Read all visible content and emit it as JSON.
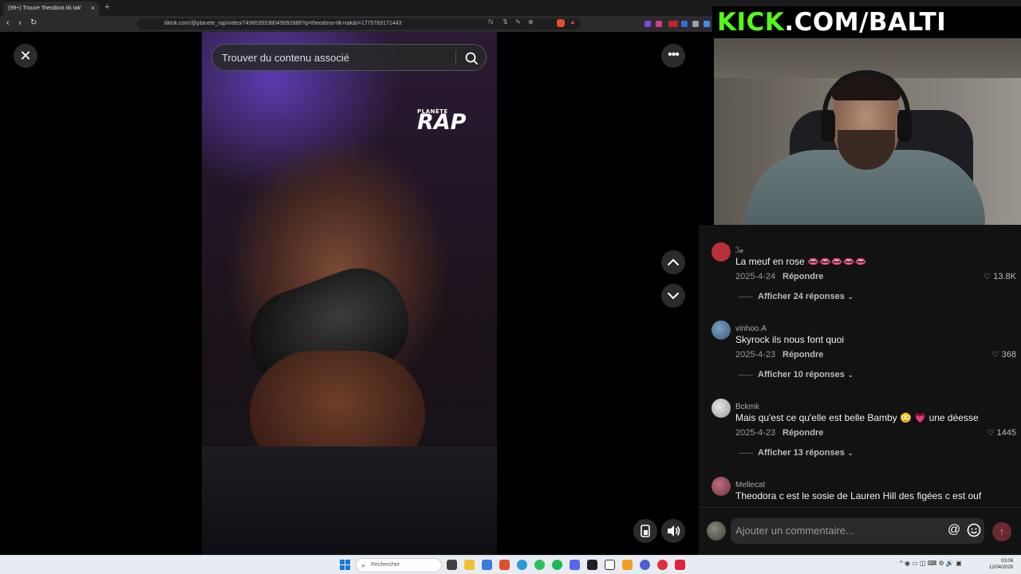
{
  "browser": {
    "tab_title": "(99+) Trouve 'theodora tik tak'",
    "tab_close": "×",
    "new_tab": "+",
    "url": "tiktok.com/@planete_rap/video/7496535538049092886?q=theodora+tik+tak&t=1775783171443"
  },
  "player": {
    "close_label": "✕",
    "search_placeholder": "Trouver du contenu associé",
    "more_label": "•••",
    "logo_small": "PLANÈTE",
    "logo_big": "RAP"
  },
  "overlay": {
    "kick_prefix": "KICK",
    "kick_suffix": ".COM/BALTI"
  },
  "comments": [
    {
      "user": "ℐ𝒶",
      "text": "La meuf en rose 👄👄👄👄👄",
      "date": "2025-4-24",
      "reply": "Répondre",
      "likes": "13.8K",
      "show_replies": "Afficher 24 réponses",
      "avatar_color": "#b8303a"
    },
    {
      "user": "vinhoo.A",
      "text": "Skyrock ils nous font quoi",
      "date": "2025-4-23",
      "reply": "Répondre",
      "likes": "368",
      "show_replies": "Afficher 10 réponses",
      "avatar_color": "#3d5a7a"
    },
    {
      "user": "Bckmk",
      "text": "Mais qu'est ce qu'elle est belle Bamby 😳 💗 une déesse",
      "date": "2025-4-23",
      "reply": "Répondre",
      "likes": "1445",
      "show_replies": "Afficher 13 réponses",
      "avatar_color": "#c9c9c9"
    },
    {
      "user": "Mellecat",
      "text": "Theodora c est le sosie de Lauren Hill des figées c est ouf",
      "date": "",
      "reply": "",
      "likes": "",
      "show_replies": "",
      "avatar_color": "#8a4a5a"
    }
  ],
  "comment_bar": {
    "placeholder": "Ajouter un commentaire...",
    "at_label": "@",
    "send_label": "↑"
  },
  "taskbar": {
    "search_label": "Rechercher",
    "tray_label": "^  ◉  ▭  ◫  ⌨  ⚙  🔊  ▣",
    "time": "03:06",
    "date": "12/04/2026"
  }
}
